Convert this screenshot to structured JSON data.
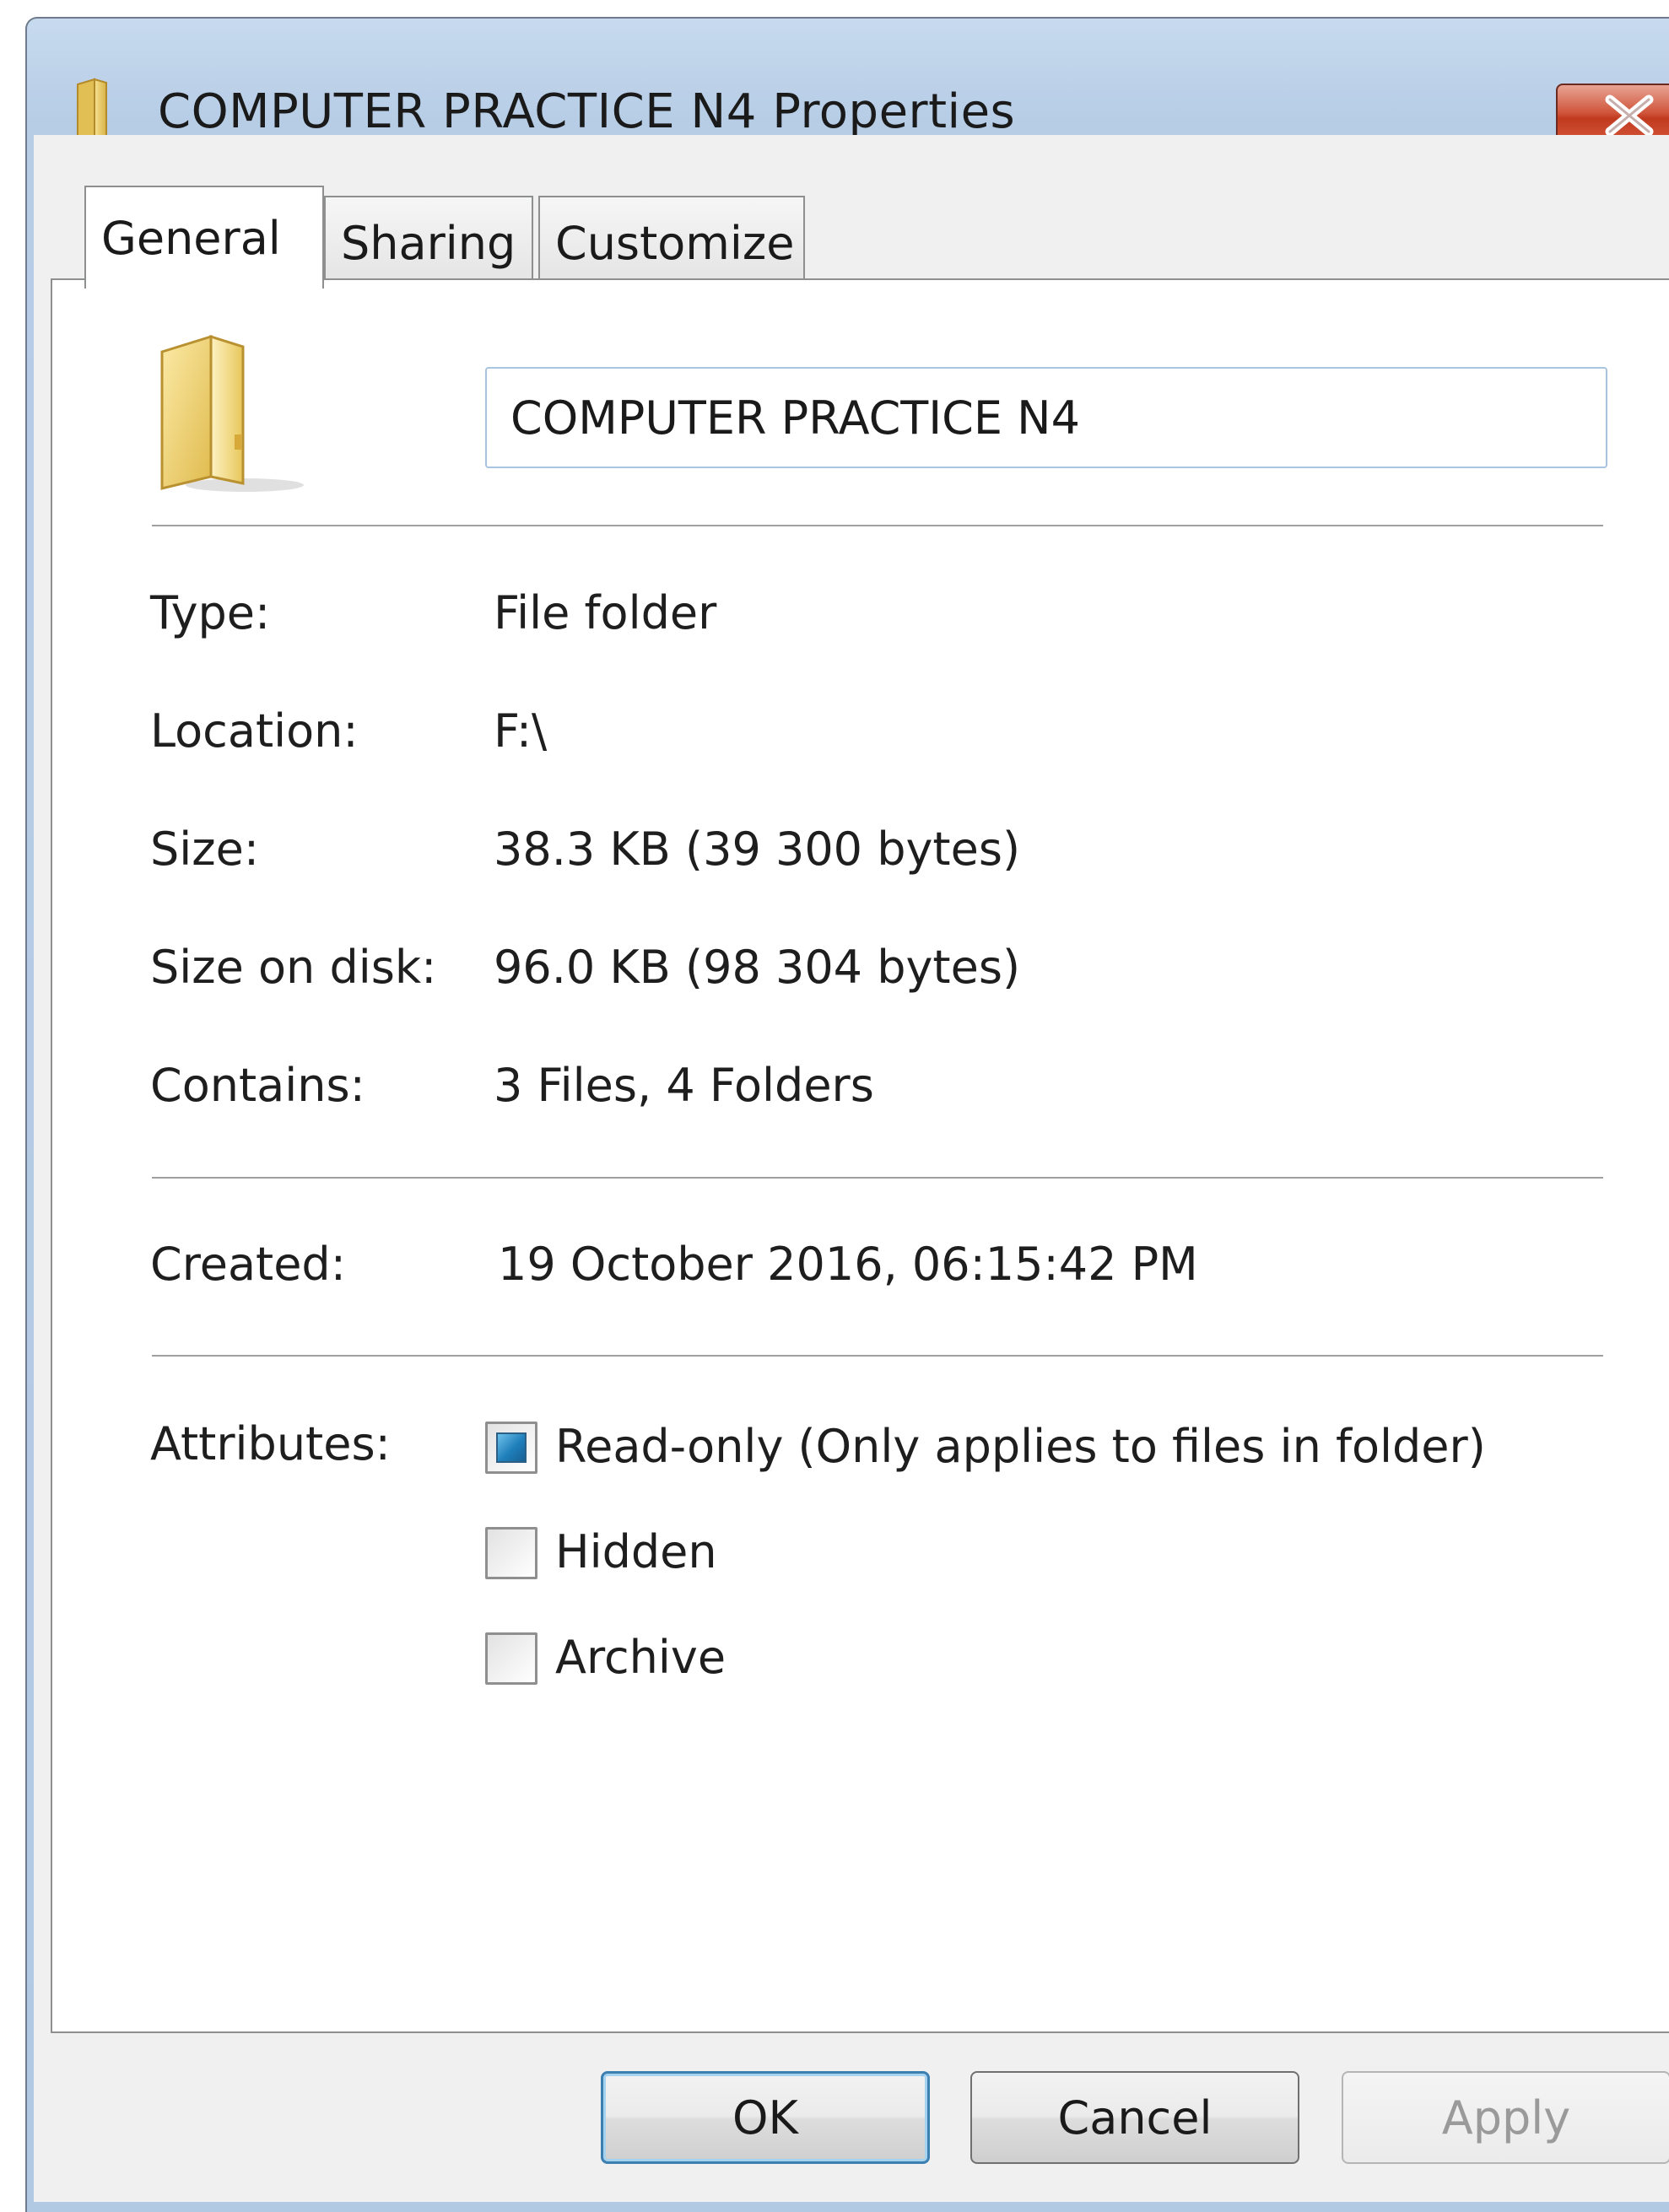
{
  "window": {
    "title": "COMPUTER PRACTICE N4 Properties",
    "close_icon": "close-icon"
  },
  "tabs": [
    {
      "label": "General",
      "active": true
    },
    {
      "label": "Sharing",
      "active": false
    },
    {
      "label": "Customize",
      "active": false
    }
  ],
  "general": {
    "folder_icon": "folder-icon",
    "name_value": "COMPUTER PRACTICE N4",
    "rows": [
      {
        "label": "Type:",
        "value": "File folder"
      },
      {
        "label": "Location:",
        "value": "F:\\"
      },
      {
        "label": "Size:",
        "value": "38.3 KB (39 300 bytes)"
      },
      {
        "label": "Size on disk:",
        "value": "96.0 KB (98 304 bytes)"
      },
      {
        "label": "Contains:",
        "value": "3 Files, 4 Folders"
      }
    ],
    "created": {
      "label": "Created:",
      "value": "19 October 2016, 06:15:42 PM"
    },
    "attributes": {
      "label": "Attributes:",
      "items": [
        {
          "label": "Read-only (Only applies to files in folder)",
          "state": "indeterminate"
        },
        {
          "label": "Hidden",
          "state": "unchecked"
        },
        {
          "label": "Archive",
          "state": "unchecked"
        }
      ]
    }
  },
  "buttons": {
    "ok": "OK",
    "cancel": "Cancel",
    "apply": "Apply"
  },
  "colors": {
    "accent": "#1f7fba",
    "close_button": "#c13a1f",
    "frame": "#b7cde6"
  }
}
